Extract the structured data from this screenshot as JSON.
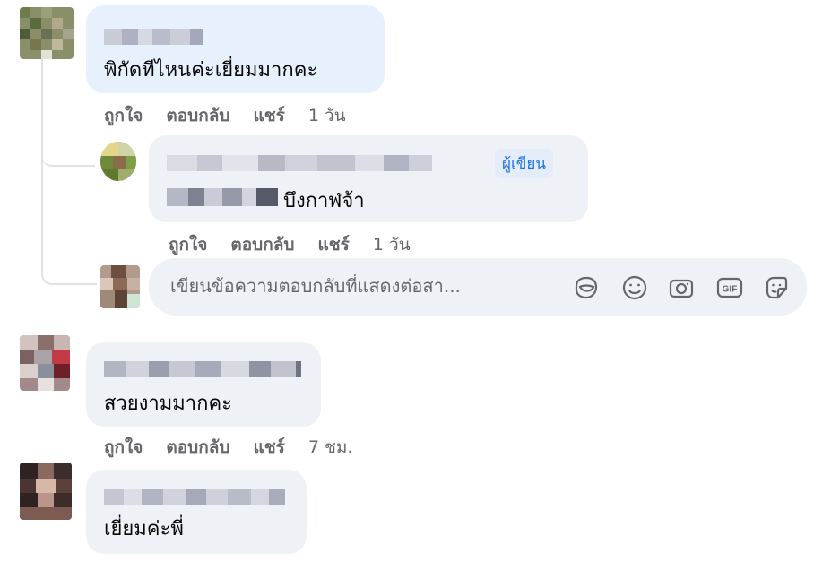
{
  "comments": [
    {
      "text": "พิกัดทีไหนค่ะเยี่ยมมากคะ",
      "actions": {
        "like": "ถูกใจ",
        "reply": "ตอบกลับ",
        "share": "แชร์"
      },
      "time": "1 วัน"
    },
    {
      "text": "บึงกาฬจ้า",
      "badge": "ผู้เขียน",
      "actions": {
        "like": "ถูกใจ",
        "reply": "ตอบกลับ",
        "share": "แชร์"
      },
      "time": "1 วัน"
    },
    {
      "text": "สวยงามมากคะ",
      "actions": {
        "like": "ถูกใจ",
        "reply": "ตอบกลับ",
        "share": "แชร์"
      },
      "time": "7 ชม."
    },
    {
      "text": "เยี่ยมค่ะพี่"
    }
  ],
  "reply_box": {
    "placeholder": "เขียนข้อความตอบกลับที่แสดงต่อสา...",
    "tools": [
      "avatar-sticker-icon",
      "emoji-icon",
      "camera-icon",
      "gif-icon",
      "sticker-icon"
    ]
  },
  "colors": {
    "bubble": "#eef2f7",
    "highlight_bubble": "#e7f0fd",
    "action_text": "#65676b",
    "badge_text": "#1b74e4"
  }
}
